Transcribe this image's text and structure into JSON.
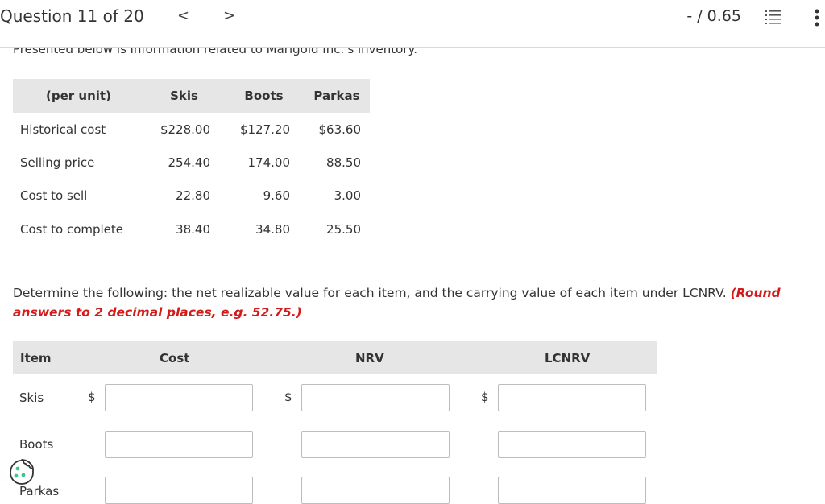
{
  "header": {
    "question_title": "Question 11 of 20",
    "prev_label": "<",
    "next_label": ">",
    "score": "- / 0.65",
    "icons": {
      "list": "list-icon",
      "more": "more-vertical-icon"
    }
  },
  "intro": "Presented below is information related to Marigold Inc.'s inventory.",
  "info_table": {
    "headers": [
      "(per unit)",
      "Skis",
      "Boots",
      "Parkas"
    ],
    "rows": [
      [
        "Historical cost",
        "$228.00",
        "$127.20",
        "$63.60"
      ],
      [
        "Selling price",
        "254.40",
        "174.00",
        "88.50"
      ],
      [
        "Cost to sell",
        "22.80",
        "9.60",
        "3.00"
      ],
      [
        "Cost to complete",
        "38.40",
        "34.80",
        "25.50"
      ]
    ]
  },
  "instructions": {
    "text": "Determine the following: the net realizable value for each item, and the carrying value of each item under LCNRV.",
    "note": "(Round answers to 2 decimal places, e.g. 52.75.)"
  },
  "answer_table": {
    "headers": [
      "Item",
      "Cost",
      "NRV",
      "LCNRV"
    ],
    "currency": "$",
    "rows": [
      {
        "item": "Skis",
        "cost": "",
        "nrv": "",
        "lcnrv": ""
      },
      {
        "item": "Boots",
        "cost": "",
        "nrv": "",
        "lcnrv": ""
      },
      {
        "item": "Parkas",
        "cost": "",
        "nrv": "",
        "lcnrv": ""
      }
    ]
  },
  "colors": {
    "accent_red": "#d51a1a",
    "header_gray": "#e6e6e6",
    "cookie_green": "#3cc88c"
  },
  "widgets": {
    "cookie": "cookie-icon"
  }
}
